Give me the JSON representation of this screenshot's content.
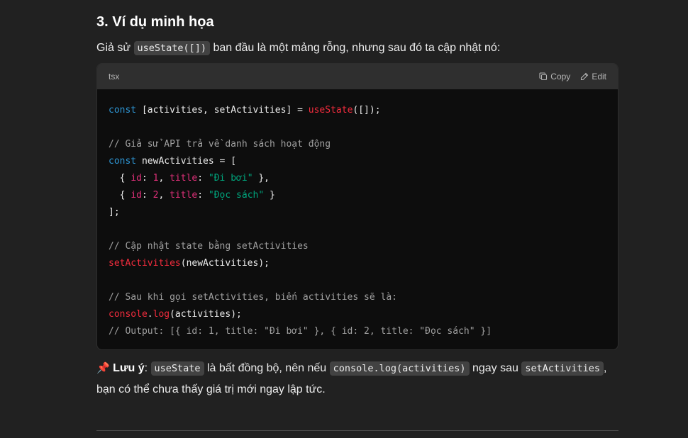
{
  "heading": "3. Ví dụ minh họa",
  "intro": {
    "before": "Giả sử ",
    "code": "useState([])",
    "after": " ban đầu là một mảng rỗng, nhưng sau đó ta cập nhật nó:"
  },
  "code_block": {
    "language": "tsx",
    "copy_label": "Copy",
    "edit_label": "Edit",
    "lines": {
      "l1": {
        "kw": "const",
        "a": " [activities, setActivities] = ",
        "fn": "useState",
        "b": "([]);"
      },
      "l3": "// Giả sử API trả về danh sách hoạt động",
      "l4": {
        "kw": "const",
        "a": " newActivities = ["
      },
      "l5": {
        "a": "  { ",
        "p1": "id",
        "b": ": ",
        "n": "1",
        "c": ", ",
        "p2": "title",
        "d": ": ",
        "s": "\"Đi bơi\"",
        "e": " },"
      },
      "l6": {
        "a": "  { ",
        "p1": "id",
        "b": ": ",
        "n": "2",
        "c": ", ",
        "p2": "title",
        "d": ": ",
        "s": "\"Đọc sách\"",
        "e": " }"
      },
      "l7": "];",
      "l9": "// Cập nhật state bằng setActivities",
      "l10": {
        "fn": "setActivities",
        "a": "(newActivities);"
      },
      "l12": "// Sau khi gọi setActivities, biến activities sẽ là:",
      "l13": {
        "fn1": "console",
        "a": ".",
        "fn2": "log",
        "b": "(activities);"
      },
      "l14": "// Output: [{ id: 1, title: \"Đi bơi\" }, { id: 2, title: \"Đọc sách\" }]"
    }
  },
  "note": {
    "pin": "📌",
    "label": "Lưu ý",
    "colon": ": ",
    "code1": "useState",
    "t1": " là bất đồng bộ, nên nếu ",
    "code2": "console.log(activities)",
    "t2": " ngay sau ",
    "code3": "setActivities",
    "t3": ", bạn có thể chưa thấy giá trị mới ngay lập tức."
  },
  "colors": {
    "background": "#212121",
    "code_bg": "#0d0d0d",
    "header_bg": "#2f2f2f",
    "keyword": "#2e95d3",
    "string": "#00a67d",
    "function": "#f22c3d",
    "property": "#df3079"
  }
}
